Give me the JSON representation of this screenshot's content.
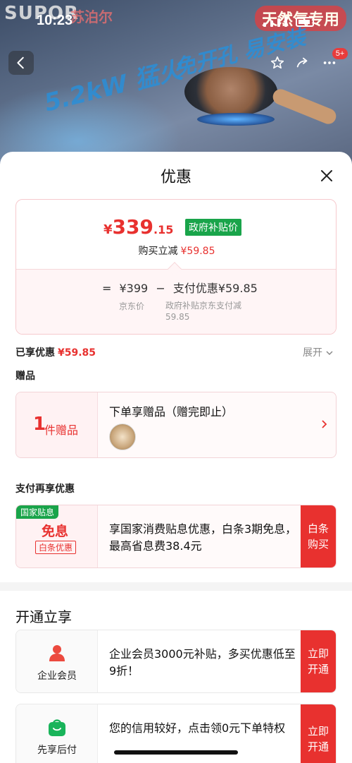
{
  "status_bar": {
    "time": "10:23"
  },
  "banner": {
    "brand": "SUPOR",
    "brand_cn": "苏泊尔",
    "badge": "天然气专用",
    "slogan_left": "5.2kW 猛火",
    "slogan_right": "免开孔 易安装",
    "more_badge": "5+"
  },
  "sheet": {
    "title": "优惠",
    "price": {
      "currency": "¥",
      "integer": "339",
      "decimal": ".15",
      "tag": "政府补贴价"
    },
    "instant_reduce": {
      "label": "购买立减",
      "amount": "¥59.85"
    },
    "calc": {
      "eq": "=",
      "jd_price": "¥399",
      "minus": "−",
      "pay_discount": "支付优惠¥59.85",
      "jd_price_label": "京东价",
      "pay_discount_label": "政府补贴京东支付减59.85"
    },
    "enjoyed": {
      "label": "已享优惠",
      "amount": "¥59.85",
      "expand": "展开"
    },
    "gift_section": {
      "label": "赠品",
      "count": "1",
      "unit": "件赠品",
      "title": "下单享赠品（赠完即止）"
    },
    "pay_section": {
      "label": "支付再享优惠",
      "tag": "国家贴息",
      "free_interest": "免息",
      "baitiao_tag": "白条优惠",
      "text": "享国家消费贴息优惠，白条3期免息，最高省息费38.4元",
      "button": "白条购买"
    },
    "open_section": {
      "title": "开通立享",
      "cards": [
        {
          "label": "企业会员",
          "text": "企业会员3000元补贴，多买优惠低至9折！",
          "button": "立即开通",
          "icon": "person-icon"
        },
        {
          "label": "先享后付",
          "text": "您的信用较好，点击领0元下单特权",
          "button": "立即开通",
          "icon": "shopping-bag-icon"
        }
      ]
    }
  },
  "colors": {
    "accent_red": "#e8312f",
    "green_tag": "#19a44a"
  }
}
